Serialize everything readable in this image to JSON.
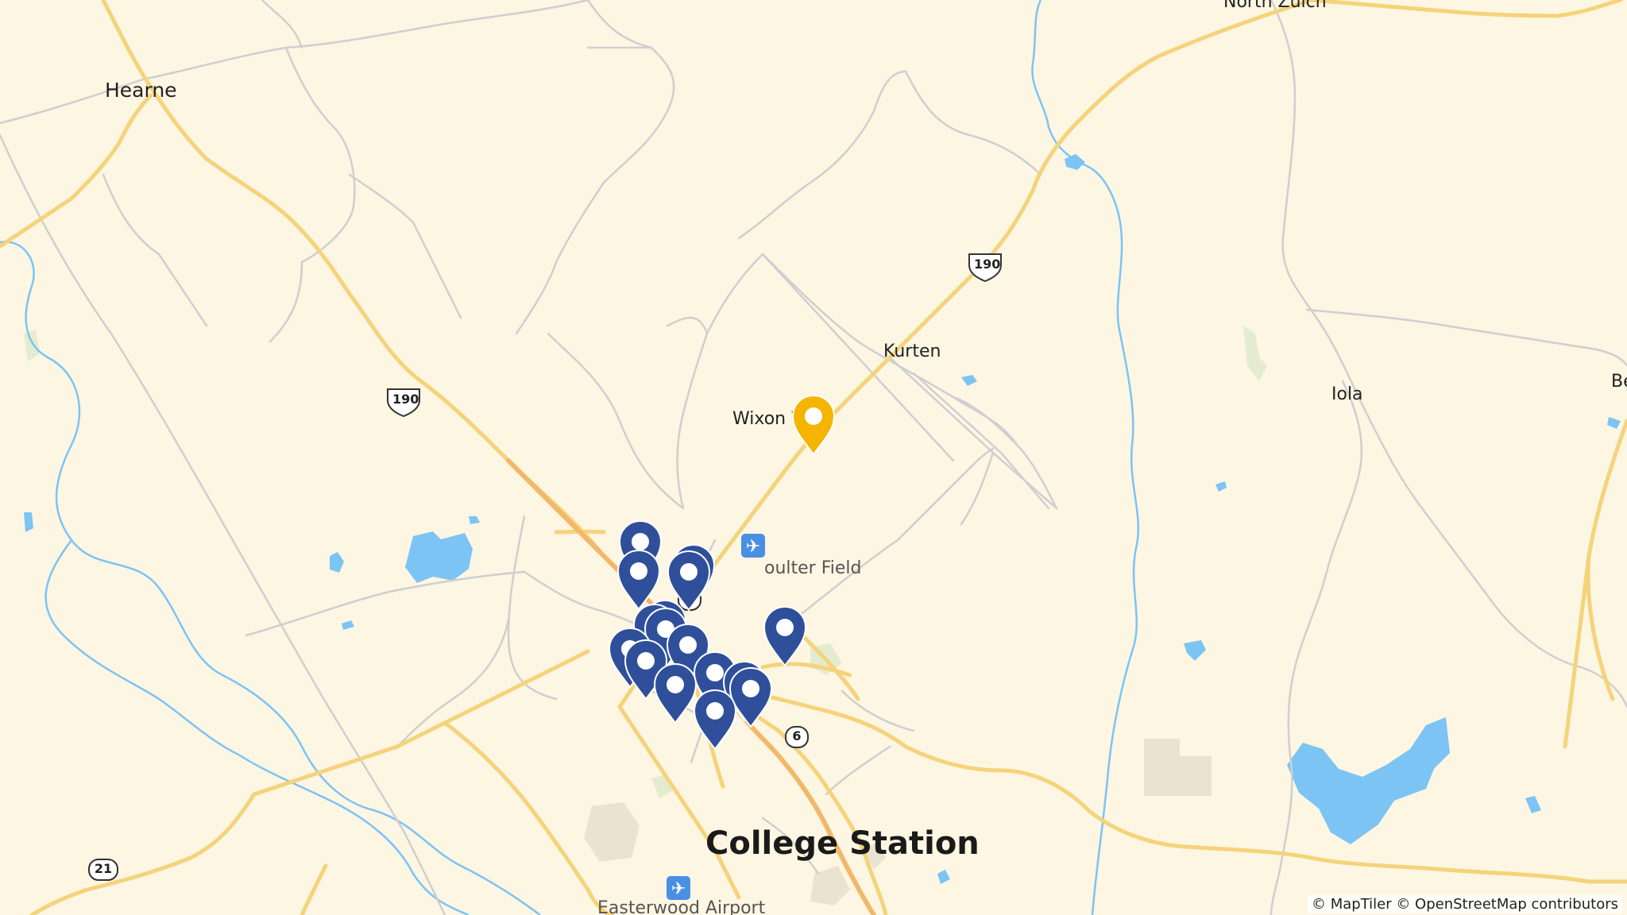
{
  "map": {
    "places": {
      "hearne": "Hearne",
      "north_zulch": "North Zulch",
      "kurten": "Kurten",
      "wixon_valley": "Wixon V",
      "iola": "Iola",
      "be_partial": "Be",
      "college_station": "College Station"
    },
    "pois": {
      "coulter_field": "oulter Field",
      "easterwood_airport": "Easterwood Airport"
    },
    "shields": {
      "us190_a": "190",
      "us190_b": "190",
      "hwy6_a": "6",
      "hwy6_b": "6",
      "hwy21": "21"
    },
    "markers": {
      "selected_count": 1,
      "cluster_count": 16,
      "selected_color": "#f5b400",
      "cluster_color": "#2f4f9a"
    },
    "attribution": "© MapTiler © OpenStreetMap contributors",
    "colors": {
      "land": "#fdf6e3",
      "water": "#7cc4f4",
      "major_road": "#f5d37a",
      "minor_road": "#cfcfcf"
    }
  }
}
